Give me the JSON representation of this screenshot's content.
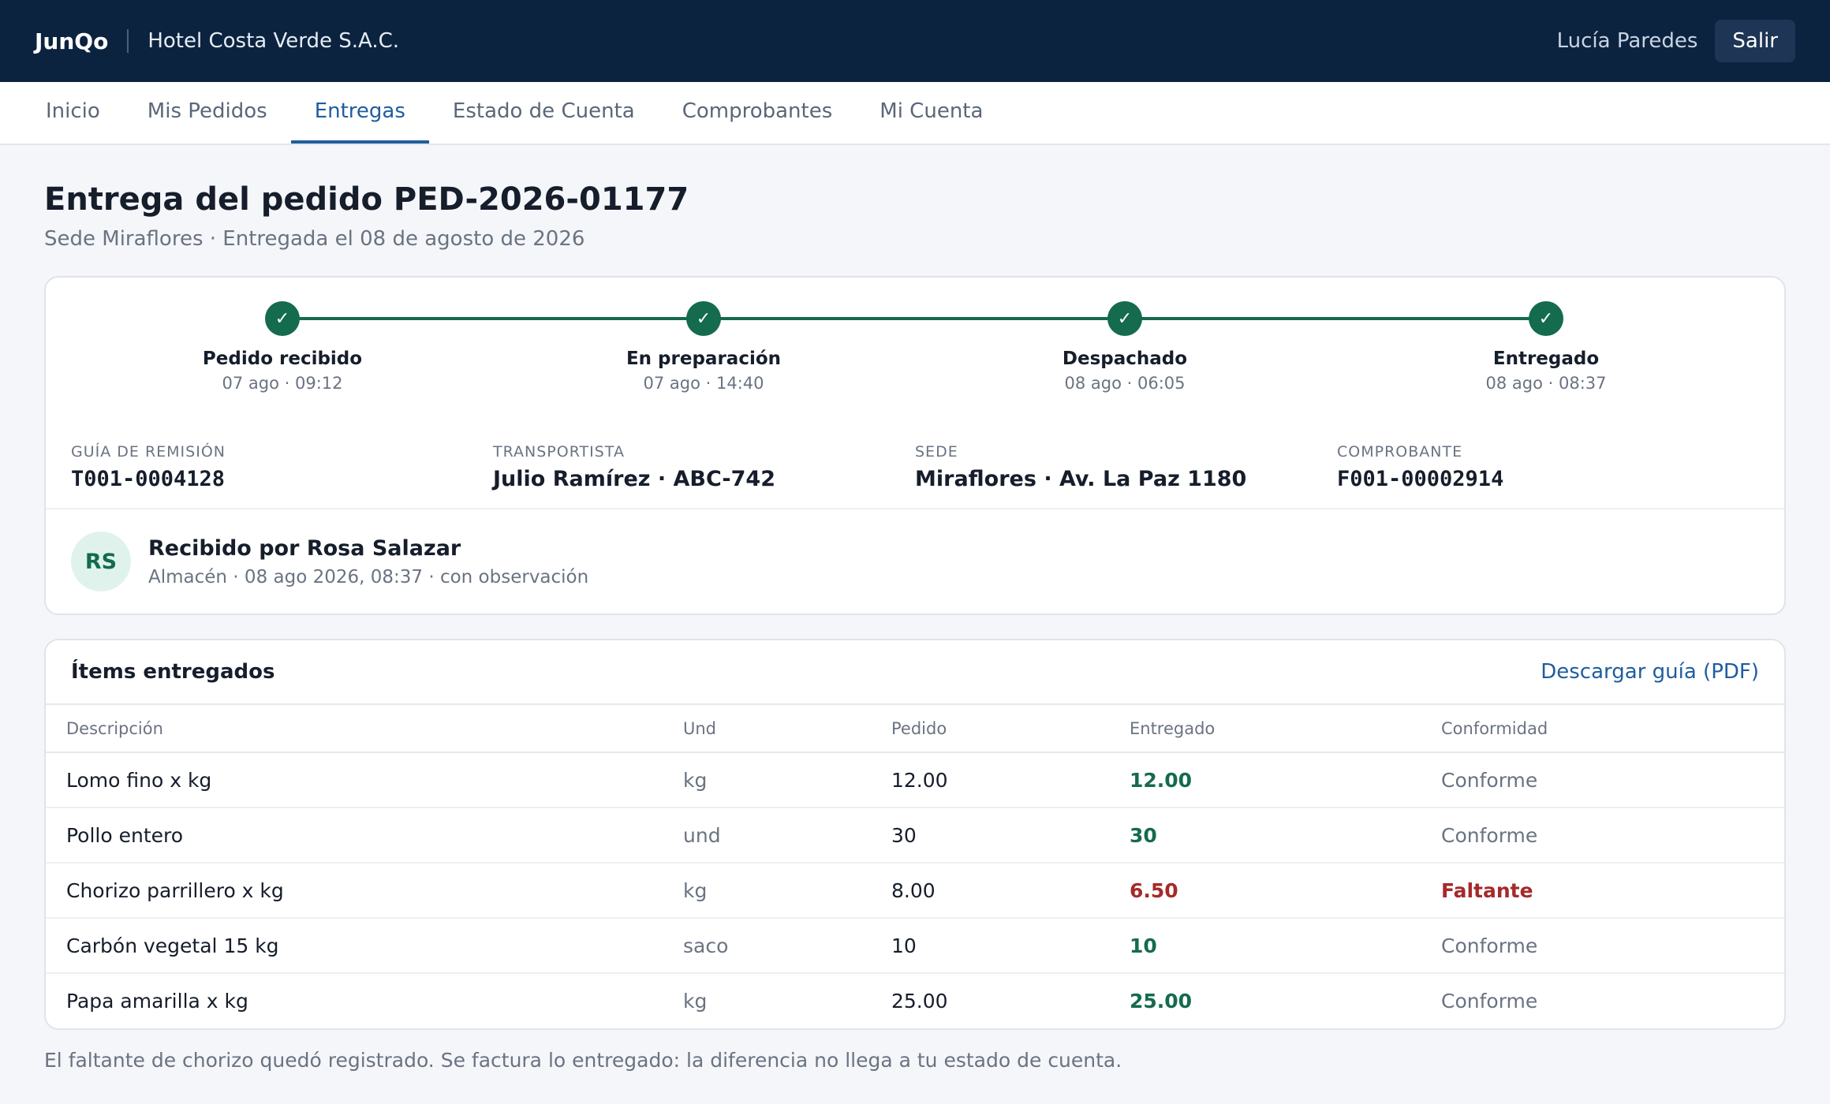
{
  "header": {
    "brand": "JunQo",
    "company": "Hotel Costa Verde S.A.C.",
    "user": "Lucía Paredes",
    "logout_label": "Salir"
  },
  "nav": [
    {
      "label": "Inicio",
      "active": false
    },
    {
      "label": "Mis Pedidos",
      "active": false
    },
    {
      "label": "Entregas",
      "active": true
    },
    {
      "label": "Estado de Cuenta",
      "active": false
    },
    {
      "label": "Comprobantes",
      "active": false
    },
    {
      "label": "Mi Cuenta",
      "active": false
    }
  ],
  "page": {
    "title": "Entrega del pedido PED-2026-01177",
    "subtitle": "Sede Miraflores · Entregada el 08 de agosto de 2026"
  },
  "timeline": [
    {
      "label": "Pedido recibido",
      "time": "07 ago · 09:12",
      "icon": "check-icon"
    },
    {
      "label": "En preparación",
      "time": "07 ago · 14:40",
      "icon": "check-icon"
    },
    {
      "label": "Despachado",
      "time": "08 ago · 06:05",
      "icon": "check-icon"
    },
    {
      "label": "Entregado",
      "time": "08 ago · 08:37",
      "icon": "check-icon"
    }
  ],
  "check_glyph": "✓",
  "meta": {
    "guia_label": "GUÍA DE REMISIÓN",
    "guia_value": "T001-0004128",
    "transportista_label": "TRANSPORTISTA",
    "transportista_value": "Julio Ramírez · ABC-742",
    "sede_label": "SEDE",
    "sede_value": "Miraflores · Av. La Paz 1180",
    "comprobante_label": "COMPROBANTE",
    "comprobante_value": "F001-00002914"
  },
  "receiver": {
    "initials": "RS",
    "title": "Recibido por Rosa Salazar",
    "meta": "Almacén · 08 ago 2026, 08:37 · con observación"
  },
  "items": {
    "title": "Ítems entregados",
    "download_label": "Descargar guía (PDF)",
    "columns": [
      "Descripción",
      "Und",
      "Pedido",
      "Entregado",
      "Conformidad"
    ],
    "rows": [
      {
        "descripcion": "Lomo fino x kg",
        "und": "kg",
        "pedido": "12.00",
        "entregado": "12.00",
        "conformidad": "Conforme"
      },
      {
        "descripcion": "Pollo entero",
        "und": "und",
        "pedido": "30",
        "entregado": "30",
        "conformidad": "Conforme"
      },
      {
        "descripcion": "Chorizo parrillero x kg",
        "und": "kg",
        "pedido": "8.00",
        "entregado": "6.50",
        "conformidad": "Faltante"
      },
      {
        "descripcion": "Carbón vegetal 15 kg",
        "und": "saco",
        "pedido": "10",
        "entregado": "10",
        "conformidad": "Conforme"
      },
      {
        "descripcion": "Papa amarilla x kg",
        "und": "kg",
        "pedido": "25.00",
        "entregado": "25.00",
        "conformidad": "Conforme"
      }
    ]
  },
  "footnote": "El faltante de chorizo quedó registrado. Se factura lo entregado: la diferencia no llega a tu estado de cuenta.",
  "colors": {
    "header_bg": "#0c2340",
    "accent": "#1f5d9e",
    "success": "#146b4e",
    "danger": "#a52a2a"
  }
}
